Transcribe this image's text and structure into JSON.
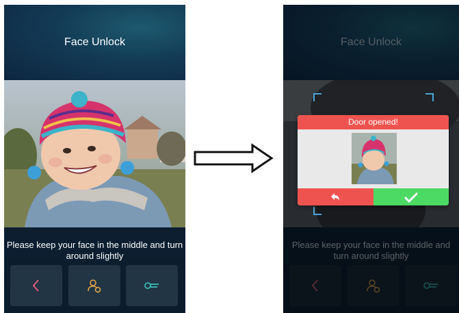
{
  "before_screen": {
    "title": "Face Unlock",
    "instruction": "Please keep your face in the middle and turn around slightly",
    "buttons": [
      {
        "name": "back",
        "icon": "chevron-left-icon",
        "color": "#e05a7a"
      },
      {
        "name": "face-enroll",
        "icon": "user-settings-icon",
        "color": "#e8a74a"
      },
      {
        "name": "password",
        "icon": "key-icon",
        "color": "#3ec9c3"
      }
    ]
  },
  "after_screen": {
    "title": "Face Unlock",
    "instruction": "Please keep your face in the middle and turn around slightly",
    "dialog": {
      "title": "Door opened!",
      "back_icon": "undo-arrow-icon",
      "confirm_icon": "checkmark-icon",
      "header_color": "#ef5350",
      "confirm_color": "#4cd964"
    }
  },
  "transition_icon": "right-arrow-icon"
}
